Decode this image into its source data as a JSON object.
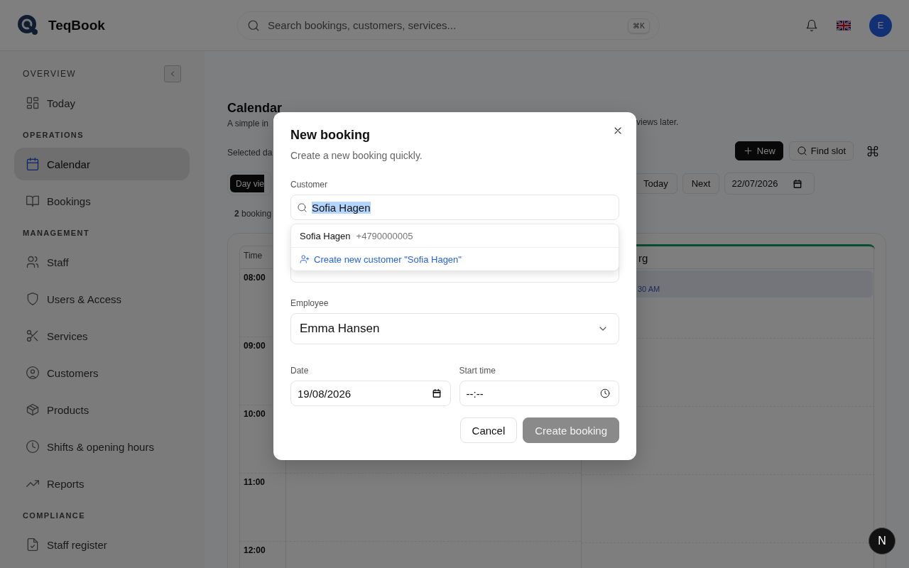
{
  "header": {
    "brand": "TeqBook",
    "search": {
      "placeholder": "Search bookings, customers, services...",
      "shortcut": "⌘K"
    },
    "avatar": "E"
  },
  "sidebar": {
    "sections": [
      {
        "title": "OVERVIEW",
        "items": [
          {
            "label": "Today",
            "selected": false
          }
        ]
      },
      {
        "title": "OPERATIONS",
        "items": [
          {
            "label": "Calendar",
            "selected": true
          },
          {
            "label": "Bookings",
            "selected": false
          }
        ]
      },
      {
        "title": "MANAGEMENT",
        "items": [
          {
            "label": "Staff",
            "selected": false
          },
          {
            "label": "Users & Access",
            "selected": false
          },
          {
            "label": "Services",
            "selected": false
          },
          {
            "label": "Customers",
            "selected": false
          },
          {
            "label": "Products",
            "selected": false
          },
          {
            "label": "Shifts & opening hours",
            "selected": false
          },
          {
            "label": "Reports",
            "selected": false
          }
        ]
      },
      {
        "title": "COMPLIANCE",
        "items": [
          {
            "label": "Staff register",
            "selected": false
          }
        ]
      }
    ]
  },
  "calendar": {
    "title": "Calendar",
    "subtitle_start": "A simple in",
    "subtitle_end": "views later.",
    "selected_date_label": "Selected da",
    "actions": [
      {
        "label": "New",
        "kind": "primary"
      },
      {
        "label": "Find slot",
        "kind": "secondary"
      }
    ],
    "view_tabs": [
      {
        "label": "Day vie",
        "selected": true
      }
    ],
    "nav_buttons": [
      "Today",
      "Next"
    ],
    "date": "22/07/2026",
    "count": "**2** booking",
    "time_header": "Time",
    "times": [
      "08:00",
      "09:00",
      "10:00",
      "11:00",
      "12:00"
    ],
    "column_header": "rg",
    "booking": {
      "time": "30 AM"
    }
  },
  "modal": {
    "title": "New booking",
    "subtitle": "Create a new booking quickly.",
    "customer": {
      "label": "Customer",
      "value": "Sofia Hagen",
      "text_selected": true
    },
    "suggestions": [
      {
        "name": "Sofia Hagen",
        "phone": "+4790000005"
      }
    ],
    "create_option": "Create new customer \"Sofia Hagen\"",
    "employee": {
      "label": "Employee",
      "value": "Emma Hansen"
    },
    "date": {
      "label": "Date",
      "value": "19/08/2026"
    },
    "start_time": {
      "label": "Start time",
      "value": "--:--"
    },
    "buttons": [
      {
        "label": "Cancel",
        "kind": "secondary",
        "disabled": false
      },
      {
        "label": "Create booking",
        "kind": "primary",
        "disabled": true
      }
    ]
  },
  "dev_badge": "N"
}
